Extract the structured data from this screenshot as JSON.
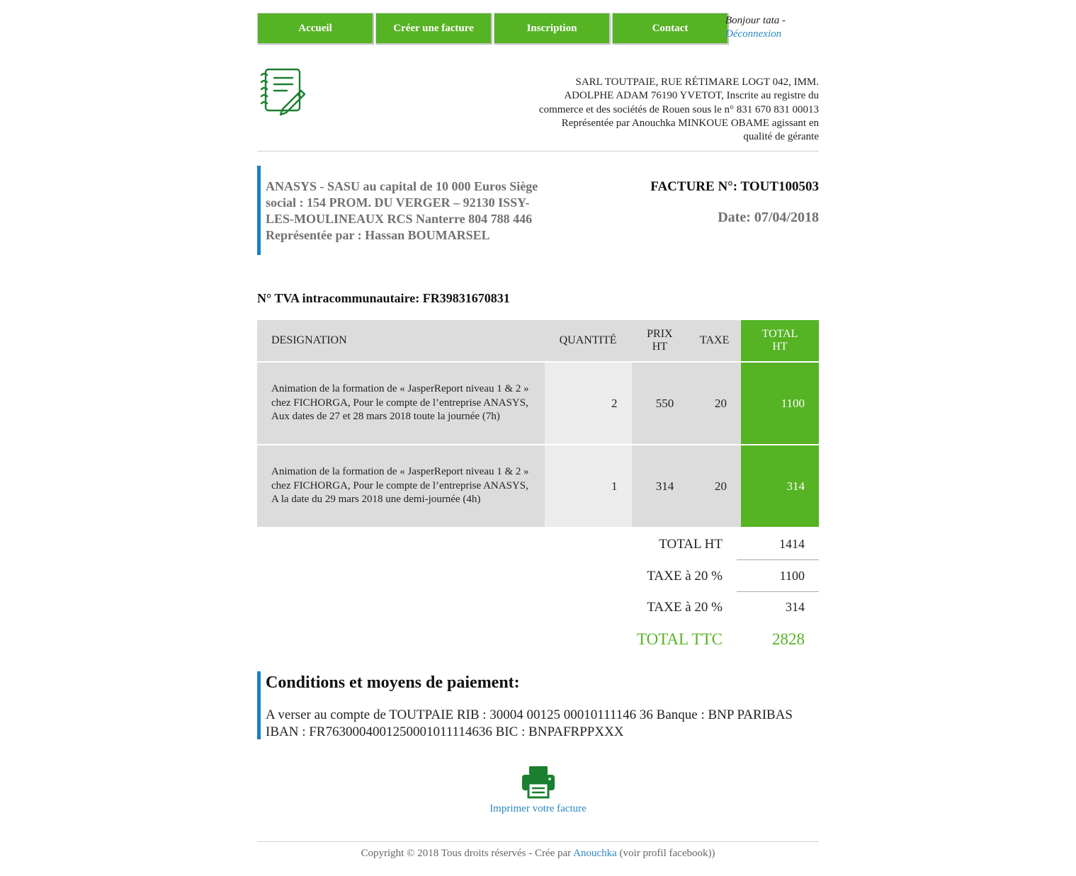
{
  "nav": {
    "items": [
      "Accueil",
      "Créer une facture",
      "Inscription",
      "Contact"
    ],
    "greeting": "Bonjour tata -",
    "logout": "Déconnexion"
  },
  "company": {
    "info": "SARL TOUTPAIE, RUE RÉTIMARE LOGT 042, IMM. ADOLPHE ADAM 76190 YVETOT, Inscrite au registre du commerce et des sociétés de Rouen sous le n° 831 670 831 00013 Représentée par Anouchka MINKOUE OBAME agissant en qualité de gérante"
  },
  "client": {
    "info": "ANASYS - SASU au capital de 10 000 Euros Siège social : 154 PROM. DU VERGER – 92130 ISSY-LES-MOULINEAUX RCS Nanterre 804 788 446 Représentée par : Hassan BOUMARSEL"
  },
  "invoice": {
    "number_label": "FACTURE N°: TOUT100503",
    "date_label": "Date: 07/04/2018",
    "tva_label": "N° TVA intracommunautaire: FR39831670831"
  },
  "table": {
    "headers": [
      "DESIGNATION",
      "QUANTITÉ",
      "PRIX HT",
      "TAXE",
      "TOTAL HT"
    ],
    "rows": [
      {
        "designation": "Animation de la formation de « JasperReport niveau 1 & 2 » chez FICHORGA, Pour le compte de l’entreprise ANASYS, Aux dates de 27 et 28 mars 2018 toute la journée (7h)",
        "quantite": "2",
        "prix": "550",
        "taxe": "20",
        "total": "1100"
      },
      {
        "designation": "Animation de la formation de « JasperReport niveau 1 & 2 » chez FICHORGA, Pour le compte de l’entreprise ANASYS, A la date du 29 mars 2018 une demi-journée (4h)",
        "quantite": "1",
        "prix": "314",
        "taxe": "20",
        "total": "314"
      }
    ]
  },
  "totals": {
    "total_ht_label": "TOTAL HT",
    "total_ht_value": "1414",
    "tax1_label": "TAXE à 20 %",
    "tax1_value": "1100",
    "tax2_label": "TAXE à 20 %",
    "tax2_value": "314",
    "ttc_label": "TOTAL TTC",
    "ttc_value": "2828"
  },
  "payment": {
    "title": "Conditions et moyens de paiement:",
    "text": "A verser au compte de TOUTPAIE RIB : 30004 00125 00010111146 36 Banque : BNP PARIBAS IBAN : FR7630004001250001011114636 BIC : BNPAFRPPXXX"
  },
  "print": {
    "label": "Imprimer votre facture",
    "icon": "printer-icon"
  },
  "footer": {
    "prefix": "Copyright © 2018 Tous droits réservés - Crée par",
    "author": "Anouchka",
    "suffix": "(voir profil facebook))"
  },
  "colors": {
    "brand_green": "#56b324",
    "accent_blue": "#1a7fc4",
    "link_blue": "#2a86c0",
    "icon_green": "#1a7f2e"
  }
}
